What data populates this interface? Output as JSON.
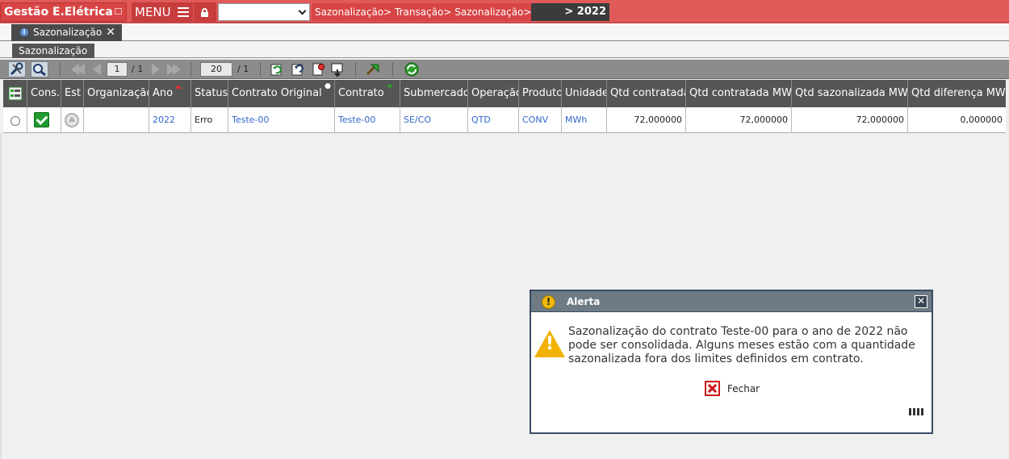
{
  "app": {
    "title": "Gestão E.Elétrica",
    "menu_label": "MENU",
    "top_select_value": "",
    "breadcrumb": "Sazonalização> Transação> Sazonalização>",
    "breadcrumb_last": "> 2022"
  },
  "tabs": [
    {
      "label": "Sazonalização",
      "close": "✕"
    }
  ],
  "subtab": {
    "label": "Sazonalização"
  },
  "toolbar": {
    "page_current": "1",
    "page_total": "/ 1",
    "page_size": "20",
    "page_size_total": "/ 1"
  },
  "table": {
    "headers": [
      "Cons.",
      "Est",
      "Organização",
      "Ano",
      "Status",
      "Contrato Original",
      "Contrato",
      "Submercado",
      "Operação",
      "Produto",
      "Unidade",
      "Qtd contratada",
      "Qtd contratada MWh",
      "Qtd sazonalizada MWh",
      "Qtd diferença MWh"
    ],
    "rows": [
      {
        "organizacao": "",
        "ano": "2022",
        "status": "Erro",
        "contrato_original": "Teste-00",
        "contrato": "Teste-00",
        "submercado": "SE/CO",
        "operacao": "QTD",
        "produto": "CONV",
        "unidade": "MWh",
        "qtd_contratada": "72,000000",
        "qtd_contratada_mwh": "72,000000",
        "qtd_sazonalizada_mwh": "72,000000",
        "qtd_diferenca_mwh": "0,000000"
      }
    ]
  },
  "modal": {
    "title": "Alerta",
    "message": "Sazonalização do contrato Teste-00 para o ano de 2022 não pode ser consolidada. Alguns meses estão com a quantidade sazonalizada fora dos limites definidos em contrato.",
    "close_label": "Fechar"
  },
  "colors": {
    "topbar": "#e05a5a",
    "header_bg": "#555555",
    "link": "#3366cc",
    "modal_border": "#3a4d66"
  }
}
